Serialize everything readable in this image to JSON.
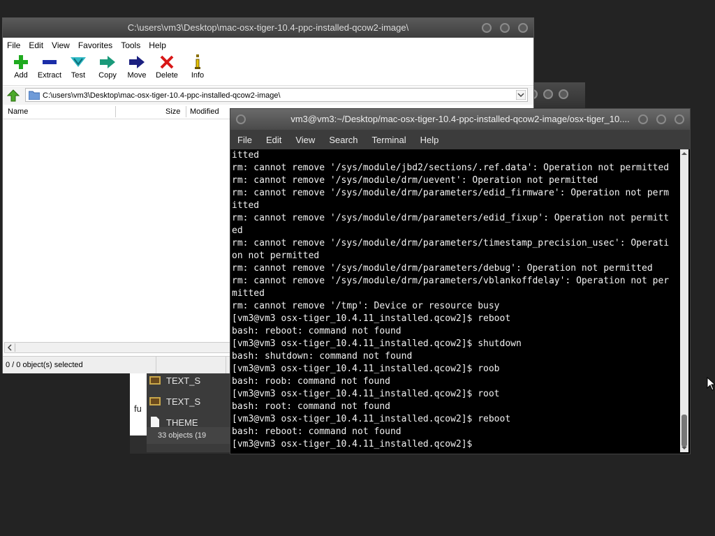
{
  "background": {
    "file_rows": [
      "TEXT_S",
      "TEXT_S",
      "THEME"
    ],
    "partial_text": "fu",
    "status_text": "33 objects (19"
  },
  "file_manager": {
    "title": "C:\\users\\vm3\\Desktop\\mac-osx-tiger-10.4-ppc-installed-qcow2-image\\",
    "menu": [
      "File",
      "Edit",
      "View",
      "Favorites",
      "Tools",
      "Help"
    ],
    "toolbar": [
      {
        "label": "Add",
        "icon": "plus-icon"
      },
      {
        "label": "Extract",
        "icon": "minus-icon"
      },
      {
        "label": "Test",
        "icon": "check-icon"
      },
      {
        "label": "Copy",
        "icon": "copy-arrow-icon"
      },
      {
        "label": "Move",
        "icon": "move-arrow-icon"
      },
      {
        "label": "Delete",
        "icon": "delete-x-icon"
      },
      {
        "label": "Info",
        "icon": "info-icon"
      }
    ],
    "address": "C:\\users\\vm3\\Desktop\\mac-osx-tiger-10.4-ppc-installed-qcow2-image\\",
    "columns": [
      "Name",
      "Size",
      "Modified"
    ],
    "status": "0 / 0 object(s) selected"
  },
  "terminal": {
    "title": "vm3@vm3:~/Desktop/mac-osx-tiger-10.4-ppc-installed-qcow2-image/osx-tiger_10....",
    "menu": [
      "File",
      "Edit",
      "View",
      "Search",
      "Terminal",
      "Help"
    ],
    "lines": [
      "itted",
      "rm: cannot remove '/sys/module/jbd2/sections/.ref.data': Operation not permitted",
      "rm: cannot remove '/sys/module/drm/uevent': Operation not permitted",
      "rm: cannot remove '/sys/module/drm/parameters/edid_firmware': Operation not perm",
      "itted",
      "rm: cannot remove '/sys/module/drm/parameters/edid_fixup': Operation not permitt",
      "ed",
      "rm: cannot remove '/sys/module/drm/parameters/timestamp_precision_usec': Operati",
      "on not permitted",
      "rm: cannot remove '/sys/module/drm/parameters/debug': Operation not permitted",
      "rm: cannot remove '/sys/module/drm/parameters/vblankoffdelay': Operation not per",
      "mitted",
      "rm: cannot remove '/tmp': Device or resource busy",
      "[vm3@vm3 osx-tiger_10.4.11_installed.qcow2]$ reboot",
      "bash: reboot: command not found",
      "[vm3@vm3 osx-tiger_10.4.11_installed.qcow2]$ shutdown",
      "bash: shutdown: command not found",
      "[vm3@vm3 osx-tiger_10.4.11_installed.qcow2]$ roob",
      "bash: roob: command not found",
      "[vm3@vm3 osx-tiger_10.4.11_installed.qcow2]$ root",
      "bash: root: command not found",
      "[vm3@vm3 osx-tiger_10.4.11_installed.qcow2]$ reboot",
      "bash: reboot: command not found",
      "[vm3@vm3 osx-tiger_10.4.11_installed.qcow2]$ "
    ]
  }
}
